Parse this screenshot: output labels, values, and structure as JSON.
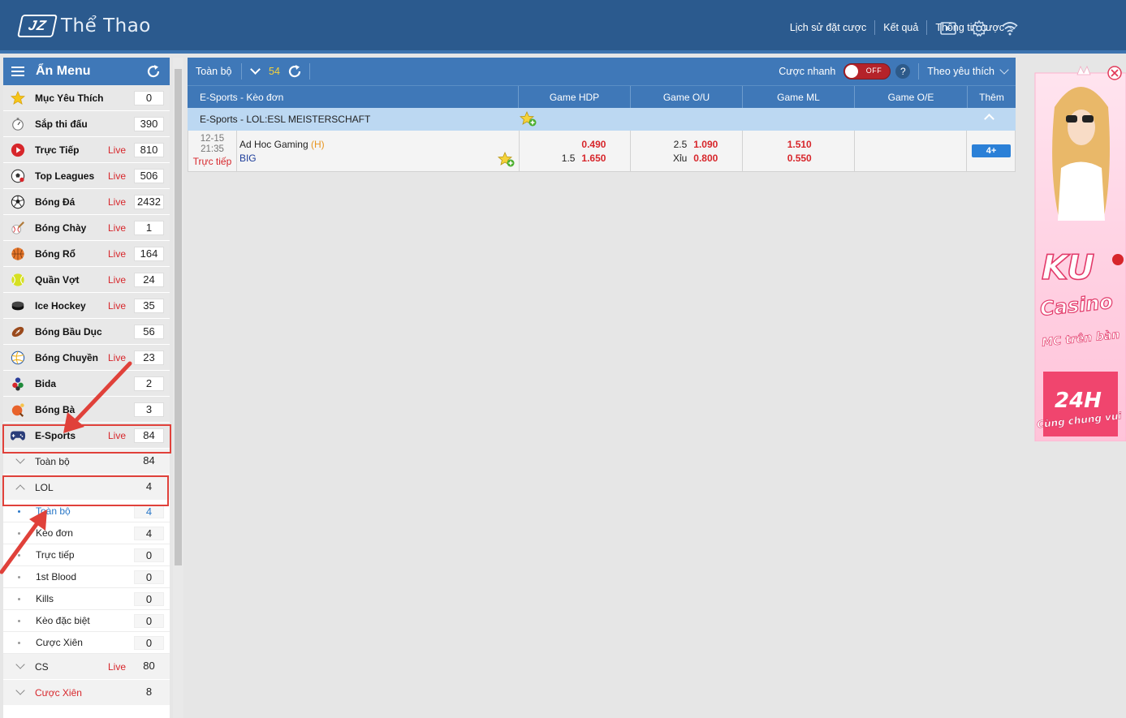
{
  "header": {
    "logo_text": "JZ",
    "title": "Thể Thao",
    "nav": [
      "Lịch sử đặt cược",
      "Kết quả",
      "Thông tin cược"
    ],
    "icons": [
      "play-icon",
      "gear-icon",
      "wifi-icon"
    ]
  },
  "sidebar": {
    "title": "Ẩn Menu",
    "live_label": "Live",
    "sports": [
      {
        "name": "Mục Yêu Thích",
        "count": "0",
        "live": false,
        "icon": "star-icon"
      },
      {
        "name": "Sắp thi đấu",
        "count": "390",
        "live": false,
        "icon": "stopwatch-icon"
      },
      {
        "name": "Trực Tiếp",
        "count": "810",
        "live": true,
        "icon": "live-play-icon"
      },
      {
        "name": "Top Leagues",
        "count": "506",
        "live": true,
        "icon": "soccer-ball-icon"
      },
      {
        "name": "Bóng Đá",
        "count": "2432",
        "live": true,
        "icon": "football-icon"
      },
      {
        "name": "Bóng Chày",
        "count": "1",
        "live": true,
        "icon": "baseball-icon"
      },
      {
        "name": "Bóng Rổ",
        "count": "164",
        "live": true,
        "icon": "basketball-icon"
      },
      {
        "name": "Quần Vợt",
        "count": "24",
        "live": true,
        "icon": "tennis-ball-icon"
      },
      {
        "name": "Ice Hockey",
        "count": "35",
        "live": true,
        "icon": "hockey-puck-icon"
      },
      {
        "name": "Bóng Bầu Dục",
        "count": "56",
        "live": false,
        "icon": "rugby-ball-icon"
      },
      {
        "name": "Bóng Chuyền",
        "count": "23",
        "live": true,
        "icon": "volleyball-icon"
      },
      {
        "name": "Bida",
        "count": "2",
        "live": false,
        "icon": "billiards-icon"
      },
      {
        "name": "Bóng Bà",
        "count": "3",
        "live": false,
        "icon": "table-tennis-icon"
      },
      {
        "name": "E-Sports",
        "count": "84",
        "live": true,
        "icon": "gamepad-icon"
      }
    ],
    "esports_all": {
      "name": "Toàn bộ",
      "count": "84"
    },
    "lol": {
      "name": "LOL",
      "count": "4"
    },
    "lol_items": [
      {
        "name": "Toàn bộ",
        "count": "4",
        "active": true
      },
      {
        "name": "Kèo đơn",
        "count": "4",
        "active": false
      },
      {
        "name": "Trực tiếp",
        "count": "0",
        "active": false
      },
      {
        "name": "1st Blood",
        "count": "0",
        "active": false
      },
      {
        "name": "Kills",
        "count": "0",
        "active": false
      },
      {
        "name": "Kèo đặc biệt",
        "count": "0",
        "active": false
      },
      {
        "name": "Cược Xiên",
        "count": "0",
        "active": false
      }
    ],
    "cs": {
      "name": "CS",
      "count": "80",
      "live": true
    },
    "parlay": {
      "name": "Cược Xiên",
      "count": "8"
    }
  },
  "toolbar": {
    "all_label": "Toàn bộ",
    "count": "54",
    "quick_bet_label": "Cược nhanh",
    "toggle_label": "OFF",
    "help": "?",
    "sort_label": "Theo yêu thích"
  },
  "table": {
    "headers": [
      "E-Sports - Kèo đơn",
      "Game HDP",
      "Game O/U",
      "Game ML",
      "Game O/E",
      "Thêm"
    ],
    "league": "E-Sports - LOL:ESL MEISTERSCHAFT",
    "match": {
      "date": "12-15",
      "time": "21:35",
      "status": "Trực tiếp",
      "home": "Ad Hoc Gaming",
      "home_tag": "(H)",
      "away": "BIG",
      "hdp_home": "0.490",
      "hdp_line": "1.5",
      "hdp_away": "1.650",
      "ou_line": "2.5",
      "ou_over": "1.090",
      "ou_under_label": "Xỉu",
      "ou_under": "0.800",
      "ml_home": "1.510",
      "ml_away": "0.550",
      "more": "4+"
    }
  },
  "ad": {
    "brand": "KU",
    "line1": "Casino",
    "line2": "MC trên bàn",
    "line3": "24H",
    "line4": "Cùng chung vui"
  },
  "colors": {
    "header_bg": "#2b5a8e",
    "bar_bg": "#3f78b8",
    "live_red": "#d7262b",
    "league_bg": "#bcd8f2",
    "highlight": "#e0413a"
  }
}
